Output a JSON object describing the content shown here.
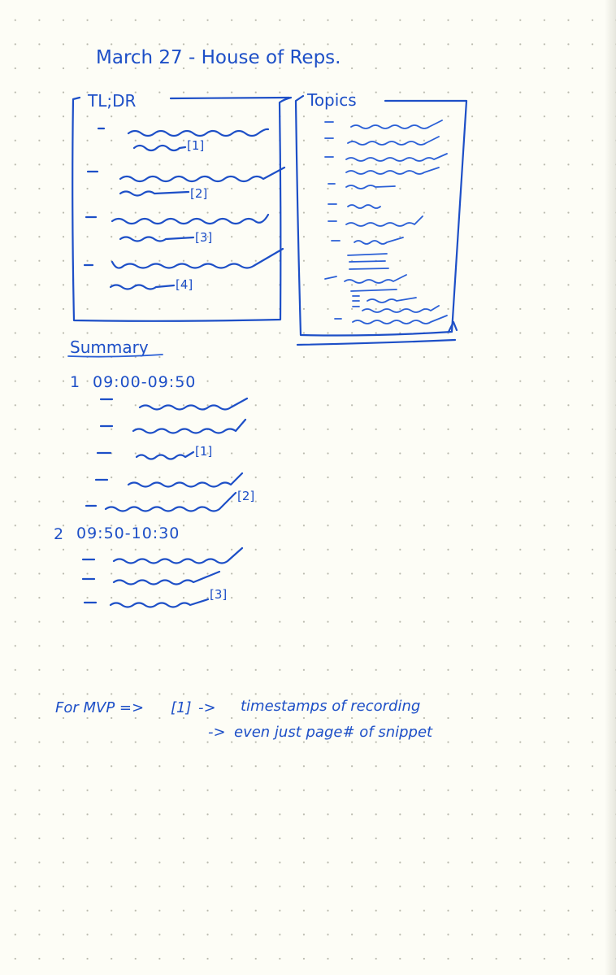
{
  "page_title": "March 27 - House of Reps.",
  "tldr": {
    "heading": "TL;DR",
    "items": [
      {
        "ref": "[1]"
      },
      {
        "ref": "[2]"
      },
      {
        "ref": "[3]"
      },
      {
        "ref": "[4]"
      }
    ]
  },
  "topics": {
    "heading": "Topics",
    "item_count": 8
  },
  "summary": {
    "heading": "Summary",
    "sections": [
      {
        "number": "1",
        "time": "09:00-09:50",
        "refs": [
          "[1]",
          "[2]"
        ]
      },
      {
        "number": "2",
        "time": "09:50-10:30",
        "refs": [
          "[3]"
        ]
      }
    ]
  },
  "notes": {
    "line1_prefix": "For MVP =>",
    "line1_ref": "[1]",
    "line1_arrow": "->",
    "line1_text": "timestamps of recording",
    "line2_arrow": "->",
    "line2_text": "even just page# of snippet"
  },
  "colors": {
    "ink": "#1d4fc7",
    "paper": "#fdfdf6",
    "dots": "#b9b9ad"
  }
}
